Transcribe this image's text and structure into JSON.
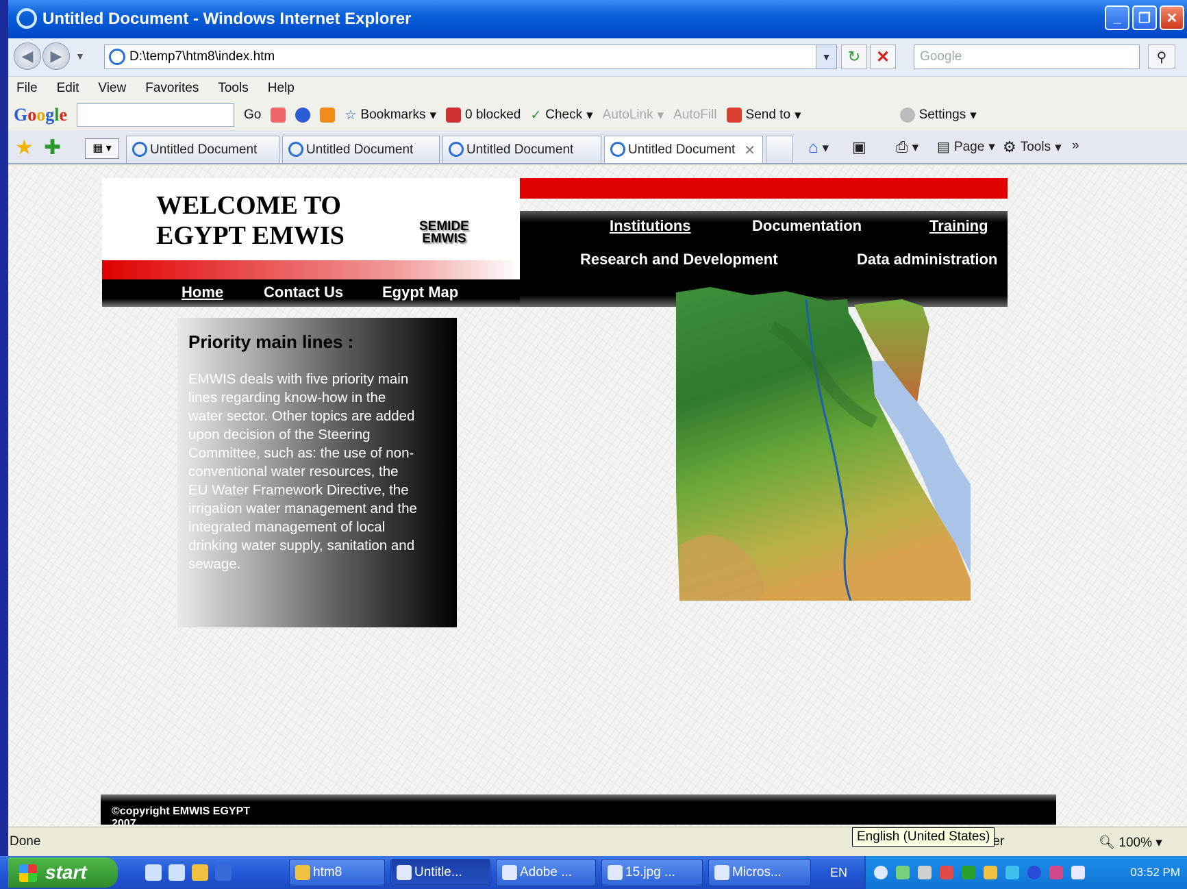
{
  "window": {
    "title": "Untitled Document - Windows Internet Explorer",
    "address": "D:\\temp7\\htm8\\index.htm",
    "search_placeholder": "Google"
  },
  "menu": [
    "File",
    "Edit",
    "View",
    "Favorites",
    "Tools",
    "Help"
  ],
  "google_toolbar": {
    "go": "Go",
    "bookmarks": "Bookmarks",
    "blocked": "0 blocked",
    "check": "Check",
    "autolink": "AutoLink",
    "autofill": "AutoFill",
    "send_to": "Send to",
    "settings": "Settings"
  },
  "tabs": [
    "Untitled Document",
    "Untitled Document",
    "Untitled Document",
    "Untitled Document"
  ],
  "command_bar": {
    "page": "Page",
    "tools": "Tools"
  },
  "page": {
    "welcome_line1": "WELCOME TO",
    "welcome_line2": "EGYPT EMWIS",
    "logo_line1": "SEMIDE",
    "logo_line2": "EMWIS",
    "nav_top": [
      "Institutions",
      "Documentation",
      "Training"
    ],
    "nav_middle": [
      "Research and Development",
      "Data administration"
    ],
    "nav_left": [
      "Home",
      "Contact Us",
      "Egypt Map"
    ],
    "priority_title": "Priority main lines :",
    "priority_text": "EMWIS deals with five priority main lines regarding know-how in the water sector. Other topics are added upon decision of the Steering Committee, such as: the use of non-conventional water resources, the EU Water Framework Directive, the irrigation water management and the integrated management of local drinking water supply, sanitation and sewage.",
    "footer": "©copyright EMWIS EGYPT 2007"
  },
  "status": {
    "text": "Done",
    "partial": "ter",
    "zoom": "100%",
    "tooltip": "English (United States)"
  },
  "taskbar": {
    "start": "start",
    "tasks": [
      "htm8",
      "Untitle...",
      "Adobe ...",
      "15.jpg ...",
      "Micros..."
    ],
    "lang": "EN",
    "clock": "03:52 PM"
  }
}
